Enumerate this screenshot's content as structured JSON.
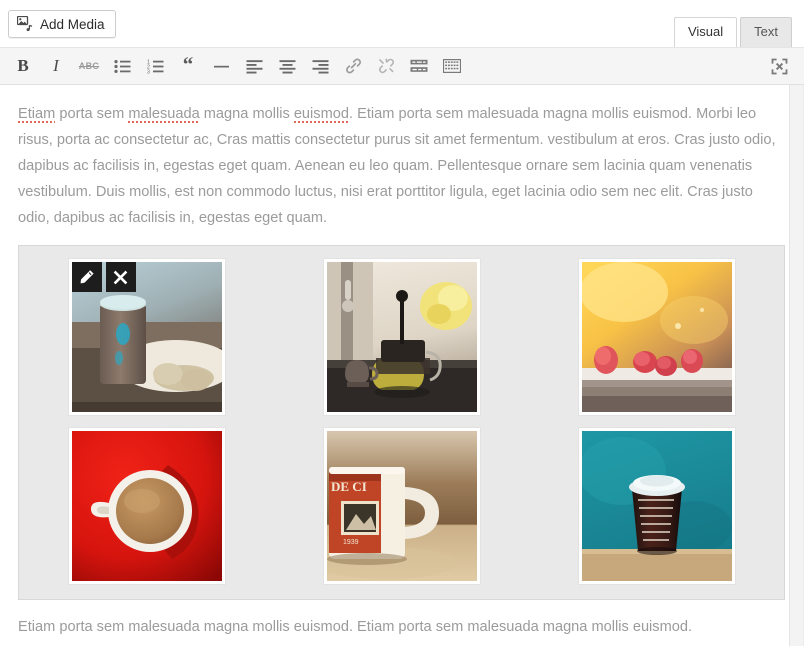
{
  "toolbar_top": {
    "add_media_label": "Add Media",
    "add_media_icon": "media-library-icon",
    "tabs": [
      {
        "label": "Visual",
        "active": true
      },
      {
        "label": "Text",
        "active": false
      }
    ]
  },
  "format_toolbar": {
    "buttons": [
      {
        "name": "bold-button",
        "icon": "bold-icon",
        "glyph": "B",
        "title": "Bold"
      },
      {
        "name": "italic-button",
        "icon": "italic-icon",
        "glyph": "I",
        "title": "Italic"
      },
      {
        "name": "strikethrough-button",
        "icon": "strikethrough-icon",
        "glyph": "ABC",
        "title": "Strikethrough"
      },
      {
        "name": "bulleted-list-button",
        "icon": "unordered-list-icon",
        "title": "Bulleted list"
      },
      {
        "name": "numbered-list-button",
        "icon": "ordered-list-icon",
        "title": "Numbered list"
      },
      {
        "name": "blockquote-button",
        "icon": "quote-icon",
        "glyph": "“",
        "title": "Blockquote"
      },
      {
        "name": "horizontal-rule-button",
        "icon": "horizontal-rule-icon",
        "title": "Horizontal line"
      },
      {
        "name": "align-left-button",
        "icon": "align-left-icon",
        "title": "Align left"
      },
      {
        "name": "align-center-button",
        "icon": "align-center-icon",
        "title": "Align center"
      },
      {
        "name": "align-right-button",
        "icon": "align-right-icon",
        "title": "Align right"
      },
      {
        "name": "insert-link-button",
        "icon": "link-icon",
        "title": "Insert/edit link"
      },
      {
        "name": "remove-link-button",
        "icon": "unlink-icon",
        "title": "Remove link"
      },
      {
        "name": "read-more-button",
        "icon": "read-more-icon",
        "title": "Insert Read More tag"
      },
      {
        "name": "toolbar-toggle-button",
        "icon": "kitchen-sink-icon",
        "title": "Toolbar Toggle"
      },
      {
        "name": "fullscreen-button",
        "icon": "fullscreen-icon",
        "title": "Distraction-free writing mode"
      }
    ]
  },
  "content": {
    "paragraph_top": {
      "spelled_words": [
        "Etiam",
        "malesuada",
        "euismod"
      ],
      "lead_prefix": " porta sem ",
      "text": "Etiam porta sem malesuada magna mollis euismod. Etiam porta sem malesuada magna mollis euismod. Morbi leo risus, porta ac consectetur ac, Cras mattis consectetur purus sit amet fermentum. vestibulum at eros. Cras justo odio, dapibus ac facilisis in, egestas eget quam. Aenean eu leo quam. Pellentesque ornare sem lacinia quam venenatis vestibulum. Duis mollis, est non commodo luctus, nisi erat porttitor ligula, eget lacinia odio sem nec elit. Cras justo odio, dapibus ac facilisis in, egestas eget quam.",
      "rest": "Etiam porta sem malesuada magna mollis euismod. Morbi leo risus, porta ac consectetur ac, Cras mattis consectetur purus sit amet fermentum. vestibulum at eros. Cras justo odio, dapibus ac facilisis in, egestas eget quam. Aenean eu leo quam. Pellentesque ornare sem lacinia quam venenatis vestibulum. Duis mollis, est non commodo luctus, nisi erat porttitor ligula, eget lacinia odio sem nec elit. Cras justo odio, dapibus ac facilisis in, egestas eget quam."
    },
    "paragraph_bottom": {
      "text": "Etiam porta sem malesuada magna mollis euismod. Etiam porta sem malesuada magna mollis euismod."
    },
    "gallery": {
      "selected_index": 0,
      "actions": [
        {
          "name": "edit-image-button",
          "icon": "pencil-icon"
        },
        {
          "name": "remove-image-button",
          "icon": "close-icon"
        }
      ],
      "rows": [
        [
          {
            "alt": "Paper coffee cup with macarons on wooden table",
            "colors": [
              "#b7cdd6",
              "#8d9aa0",
              "#cfc2ad",
              "#3a3b38"
            ]
          },
          {
            "alt": "Glass teapot with green tea and yellow roses",
            "colors": [
              "#e6e0d4",
              "#3b3330",
              "#d9c23f",
              "#2a2523"
            ]
          },
          {
            "alt": "Raspberries on a white ledge with golden bokeh",
            "colors": [
              "#f6c445",
              "#f2dc9a",
              "#d9555a",
              "#e8e4df"
            ]
          }
        ],
        [
          {
            "alt": "White coffee cup on bright red background",
            "colors": [
              "#e01b12",
              "#ffffff",
              "#b0763f",
              "#8e0b07"
            ]
          },
          {
            "alt": "Vintage stamp-print mug on sand",
            "colors": [
              "#8c6a4a",
              "#f3ece1",
              "#b4381f",
              "#d8c29b"
            ]
          },
          {
            "alt": "Takeaway coffee cup against teal wall",
            "colors": [
              "#1f8f9c",
              "#2b1410",
              "#dfe9ea",
              "#c8ab80"
            ]
          }
        ]
      ]
    }
  }
}
